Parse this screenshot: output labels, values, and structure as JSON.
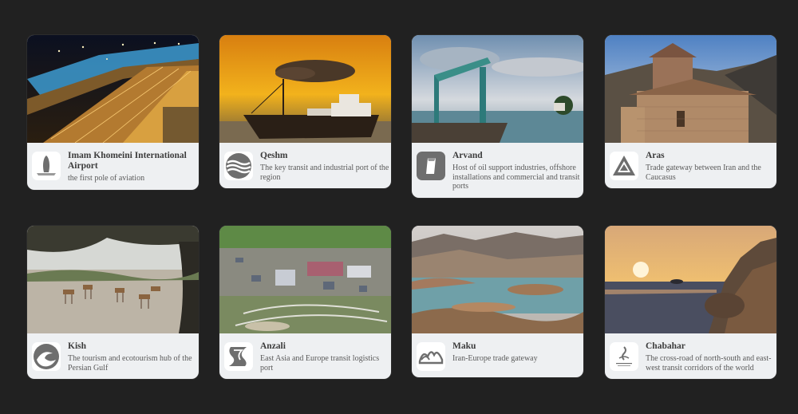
{
  "cards": [
    {
      "name": "Imam Khomeini International Airport",
      "description": "the first pole of aviation",
      "logo_icon": "airport-plane-icon"
    },
    {
      "name": "Qeshm",
      "description": "The key transit and industrial port of the region",
      "logo_icon": "waves-icon"
    },
    {
      "name": "Arvand",
      "description": "Host of oil support industries, offshore installations and commercial and transit ports",
      "logo_icon": "arvand-icon"
    },
    {
      "name": "Aras",
      "description": "Trade gateway between Iran and the Caucasus",
      "logo_icon": "mountain-triangle-icon"
    },
    {
      "name": "Kish",
      "description": "The tourism and ecotourism hub of the Persian Gulf",
      "logo_icon": "kish-wave-icon"
    },
    {
      "name": "Anzali",
      "description": "East Asia and Europe transit logistics port",
      "logo_icon": "anzali-icon"
    },
    {
      "name": "Maku",
      "description": "Iran-Europe trade gateway",
      "logo_icon": "maku-icon"
    },
    {
      "name": "Chabahar",
      "description": "The cross-road of north-south and east-west transit corridors of the world",
      "logo_icon": "chabahar-icon"
    }
  ]
}
